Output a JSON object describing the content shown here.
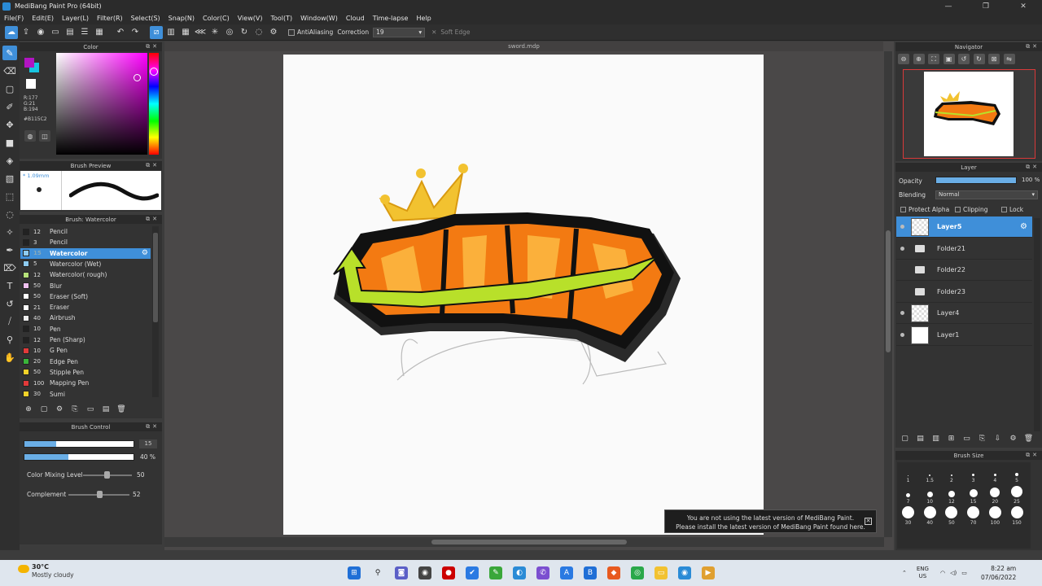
{
  "window": {
    "title": "MediBang Paint Pro (64bit)",
    "minimize": "—",
    "maximize": "❐",
    "close": "✕"
  },
  "menu": [
    "File(F)",
    "Edit(E)",
    "Layer(L)",
    "Filter(R)",
    "Select(S)",
    "Snap(N)",
    "Color(C)",
    "View(V)",
    "Tool(T)",
    "Window(W)",
    "Cloud",
    "Time-lapse",
    "Help"
  ],
  "toolbar": {
    "antialiasing_label": "AntiAliasing",
    "correction_label": "Correction",
    "correction_value": "19",
    "soft_edge_label": "Soft Edge"
  },
  "color_panel": {
    "title": "Color",
    "r": "R:177",
    "g": "G:21",
    "b": "B:194",
    "hex": "#B115C2",
    "main_color": "#b115c2",
    "sub_color": "#18c4e0"
  },
  "brush_preview": {
    "title": "Brush Preview",
    "size": "* 1.09mm"
  },
  "brush_list": {
    "title": "Brush: Watercolor",
    "items": [
      {
        "num": "12",
        "name": "Pencil",
        "color": "#222222"
      },
      {
        "num": "3",
        "name": "Pencil",
        "color": "#222222"
      },
      {
        "num": "15",
        "name": "Watercolor",
        "color": "#8ecbf0"
      },
      {
        "num": "5",
        "name": "Watercolor (Wet)",
        "color": "#8ecbf0"
      },
      {
        "num": "12",
        "name": "Watercolor( rough)",
        "color": "#b6e27a"
      },
      {
        "num": "50",
        "name": "Blur",
        "color": "#f0c0f0"
      },
      {
        "num": "50",
        "name": "Eraser (Soft)",
        "color": "#ffffff"
      },
      {
        "num": "21",
        "name": "Eraser",
        "color": "#ffffff"
      },
      {
        "num": "40",
        "name": "Airbrush",
        "color": "#eeeeee"
      },
      {
        "num": "10",
        "name": "Pen",
        "color": "#222222"
      },
      {
        "num": "12",
        "name": "Pen (Sharp)",
        "color": "#222222"
      },
      {
        "num": "10",
        "name": "G Pen",
        "color": "#e23a3a"
      },
      {
        "num": "20",
        "name": "Edge Pen",
        "color": "#3ab53a"
      },
      {
        "num": "50",
        "name": "Stipple Pen",
        "color": "#f2d22a"
      },
      {
        "num": "100",
        "name": "Mapping Pen",
        "color": "#e23a3a"
      },
      {
        "num": "30",
        "name": "Sumi",
        "color": "#f2d22a"
      }
    ]
  },
  "brush_control": {
    "title": "Brush Control",
    "size_value": "15",
    "opacity_value": "40 %",
    "size_fraction": 0.29,
    "opacity_fraction": 0.4,
    "mixing_label": "Color Mixing Level",
    "mixing_value": "50",
    "complement_label": "Complement",
    "complement_value": "52"
  },
  "document": {
    "tab": "sword.mdp"
  },
  "notice": {
    "line1": "You are not using the latest version of MediBang Paint.",
    "line2": "Please install the latest version of MediBang Paint found here."
  },
  "navigator": {
    "title": "Navigator"
  },
  "layer_panel": {
    "title": "Layer",
    "opacity_label": "Opacity",
    "opacity_value": "100 %",
    "blending_label": "Blending",
    "blending_value": "Normal",
    "protect_alpha": "Protect Alpha",
    "clipping": "Clipping",
    "lock": "Lock",
    "layers": [
      {
        "name": "Layer5",
        "kind": "layer"
      },
      {
        "name": "Folder21",
        "kind": "folder"
      },
      {
        "name": "Folder22",
        "kind": "folder"
      },
      {
        "name": "Folder23",
        "kind": "folder"
      },
      {
        "name": "Layer4",
        "kind": "layer"
      },
      {
        "name": "Layer1",
        "kind": "layer"
      }
    ]
  },
  "brush_size": {
    "title": "Brush Size",
    "sizes": [
      "1",
      "1.5",
      "2",
      "3",
      "4",
      "5",
      "7",
      "10",
      "12",
      "15",
      "20",
      "25",
      "30",
      "40",
      "50",
      "70",
      "100",
      "150"
    ]
  },
  "taskbar": {
    "temp": "30°C",
    "weather": "Mostly cloudy",
    "lang": "ENG",
    "region": "US",
    "time": "8:22 am",
    "date": "07/06/2022"
  }
}
